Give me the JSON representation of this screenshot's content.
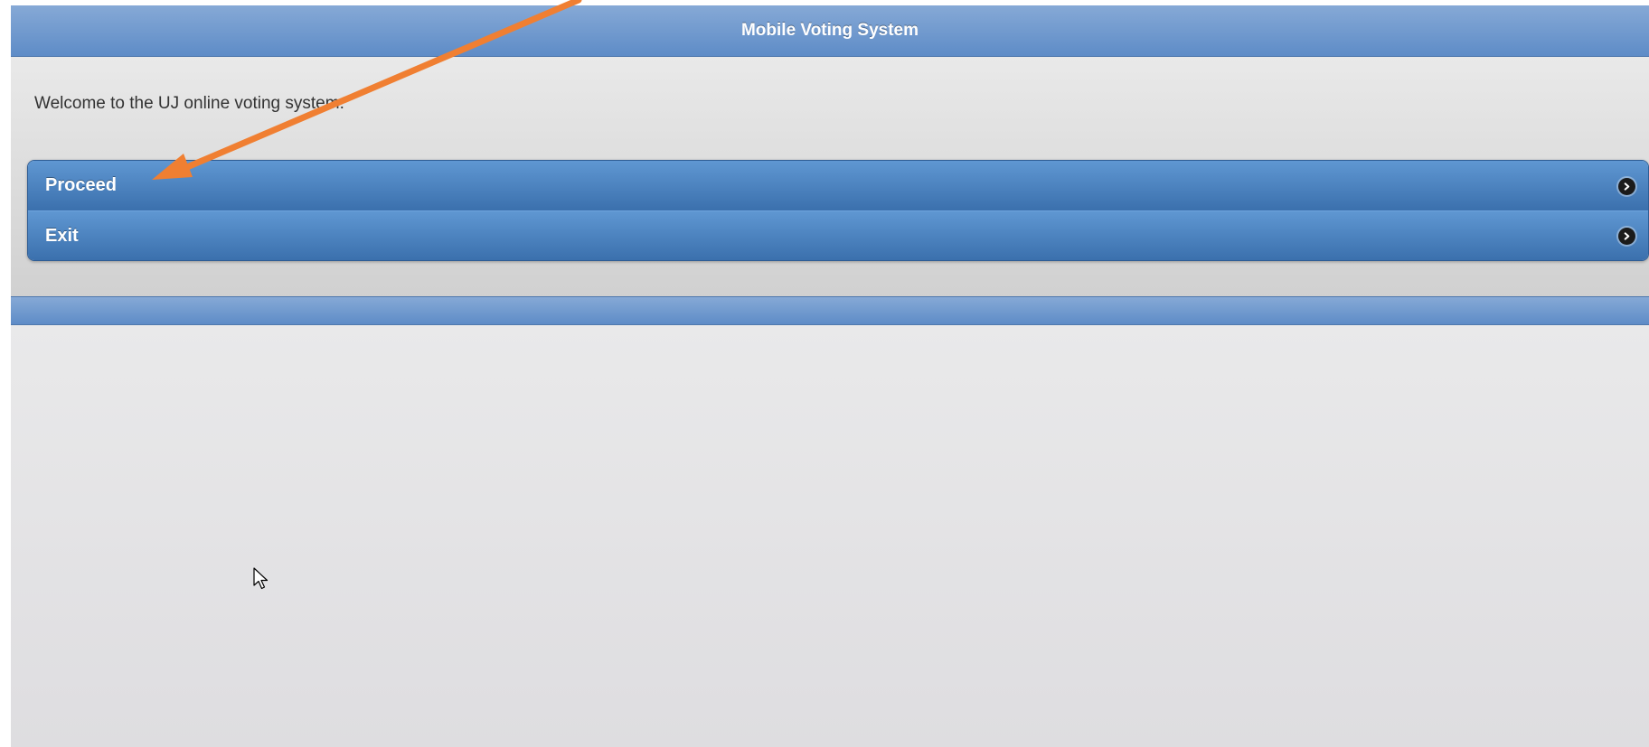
{
  "header": {
    "title": "Mobile Voting System"
  },
  "content": {
    "welcome_text": "Welcome to the UJ online voting system."
  },
  "menu": {
    "items": [
      {
        "label": "Proceed",
        "icon": "chevron-right-circle-icon"
      },
      {
        "label": "Exit",
        "icon": "chevron-right-circle-icon"
      }
    ]
  },
  "annotation": {
    "arrow_color": "#f07f32",
    "icon": "annotation-arrow"
  },
  "colors": {
    "header_blue": "#6f98cc",
    "button_blue": "#4a82c0",
    "background_gray": "#e2e2e2"
  }
}
